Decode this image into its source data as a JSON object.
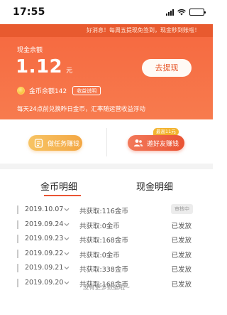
{
  "status_bar": {
    "time": "17:55",
    "battery_level": 0.85
  },
  "banner": {
    "notice": "好消息！每周五提现免签到，现金秒到账啦！",
    "cash_label": "现金余额",
    "cash_amount": "1.12",
    "cash_unit": "元",
    "withdraw_label": "去提现",
    "coin_balance": "金币余额142",
    "income_info_label": "收益说明",
    "exchange_note": "每天24点前兑换昨日金币，汇率随运营收益浮动"
  },
  "actions": {
    "task_label": "做任务赚钱",
    "invite_label": "邀好友赚钱",
    "invite_badge": "最高11元"
  },
  "tabs": [
    {
      "label": "金币明细",
      "active": true
    },
    {
      "label": "现金明细",
      "active": false
    }
  ],
  "coin_details": [
    {
      "date": "2019.10.07",
      "earned": "共获取:116金币",
      "status": "审核中",
      "pending": true
    },
    {
      "date": "2019.09.24",
      "earned": "共获取:0金币",
      "status": "已发放",
      "pending": false
    },
    {
      "date": "2019.09.23",
      "earned": "共获取:168金币",
      "status": "已发放",
      "pending": false
    },
    {
      "date": "2019.09.22",
      "earned": "共获取:0金币",
      "status": "已发放",
      "pending": false
    },
    {
      "date": "2019.09.21",
      "earned": "共获取:338金币",
      "status": "已发放",
      "pending": false
    },
    {
      "date": "2019.09.20",
      "earned": "共获取:168金币",
      "status": "已发放",
      "pending": false
    }
  ],
  "empty_note": "没有更多数据啦~",
  "colors": {
    "accent": "#ea5434",
    "banner": "#f6683f",
    "gold": "#f3a744"
  }
}
